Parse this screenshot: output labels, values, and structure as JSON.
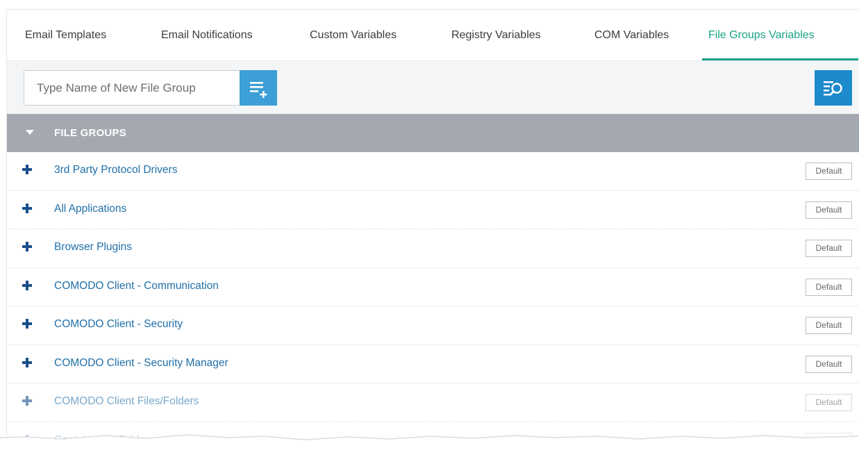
{
  "tabs": [
    {
      "label": "Email Templates",
      "active": false
    },
    {
      "label": "Email Notifications",
      "active": false
    },
    {
      "label": "Custom Variables",
      "active": false
    },
    {
      "label": "Registry Variables",
      "active": false
    },
    {
      "label": "COM Variables",
      "active": false
    },
    {
      "label": "File Groups Variables",
      "active": true
    }
  ],
  "toolbar": {
    "input_placeholder": "Type Name of New File Group",
    "input_value": "",
    "add_icon": "list-add-icon",
    "search_icon": "list-search-icon"
  },
  "section": {
    "title": "FILE GROUPS",
    "expanded": true
  },
  "rows": [
    {
      "name": "3rd Party Protocol Drivers",
      "badge": "Default"
    },
    {
      "name": "All Applications",
      "badge": "Default"
    },
    {
      "name": "Browser Plugins",
      "badge": "Default"
    },
    {
      "name": "COMODO Client - Communication",
      "badge": "Default"
    },
    {
      "name": "COMODO Client - Security",
      "badge": "Default"
    },
    {
      "name": "COMODO Client - Security Manager",
      "badge": "Default"
    },
    {
      "name": "COMODO Client Files/Folders",
      "badge": "Default"
    },
    {
      "name": "Containment Folders",
      "badge": "Default"
    }
  ],
  "colors": {
    "accent_green": "#19a287",
    "button_blue": "#3c9fd5",
    "search_blue": "#1d8acb",
    "header_gray": "#a4a9b1",
    "link_blue": "#2170a8"
  }
}
